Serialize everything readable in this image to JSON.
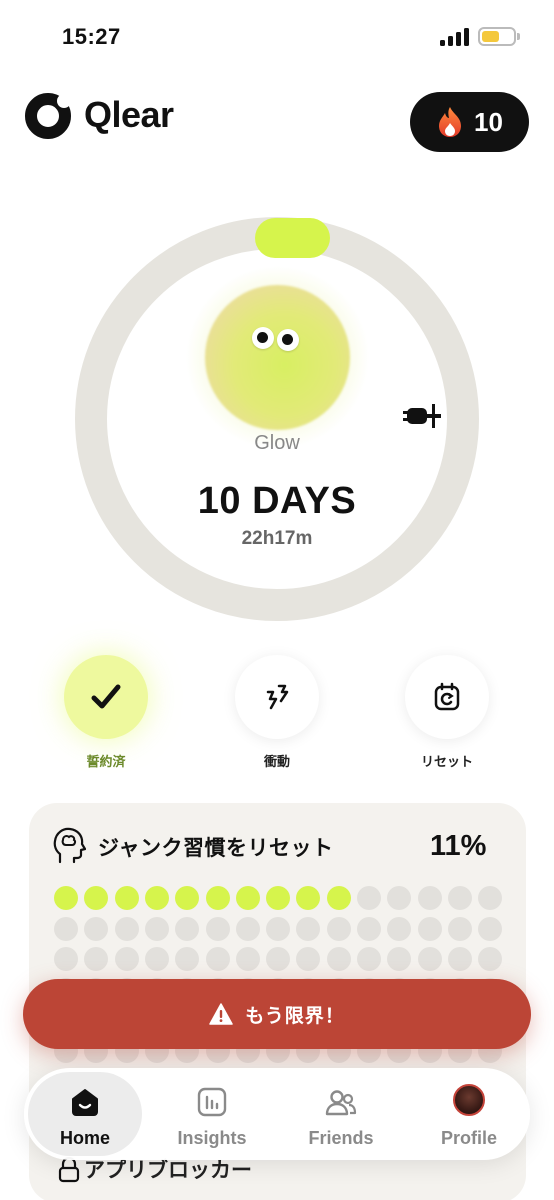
{
  "status_bar": {
    "time": "15:27"
  },
  "header": {
    "app_name": "Qlear",
    "streak_count": "10"
  },
  "tracker": {
    "creature_name": "Glow",
    "days": "10 DAYS",
    "elapsed": "22h17m",
    "colors": {
      "ring": "#e6e4de",
      "accent": "#d6f44c"
    }
  },
  "actions": [
    {
      "label": "誓約済",
      "icon": "check-icon"
    },
    {
      "label": "衝動",
      "icon": "urge-lightning-icon"
    },
    {
      "label": "リセット",
      "icon": "calendar-reset-icon"
    }
  ],
  "habit_card": {
    "title": "ジャンク習慣をリセット",
    "percent": "11%",
    "dots_per_row": 15,
    "dots_filled": 10,
    "colors": {
      "filled": "#d6f44c",
      "empty": "#e2e0dc"
    }
  },
  "limit_button": {
    "label": "もう限界！",
    "color": "#bc4536"
  },
  "partial_card": {
    "title": "アプリブロッカー"
  },
  "tabs": [
    {
      "label": "Home",
      "icon": "home-icon",
      "active": true
    },
    {
      "label": "Insights",
      "icon": "insights-icon",
      "active": false
    },
    {
      "label": "Friends",
      "icon": "friends-icon",
      "active": false
    },
    {
      "label": "Profile",
      "icon": "avatar",
      "active": false
    }
  ]
}
